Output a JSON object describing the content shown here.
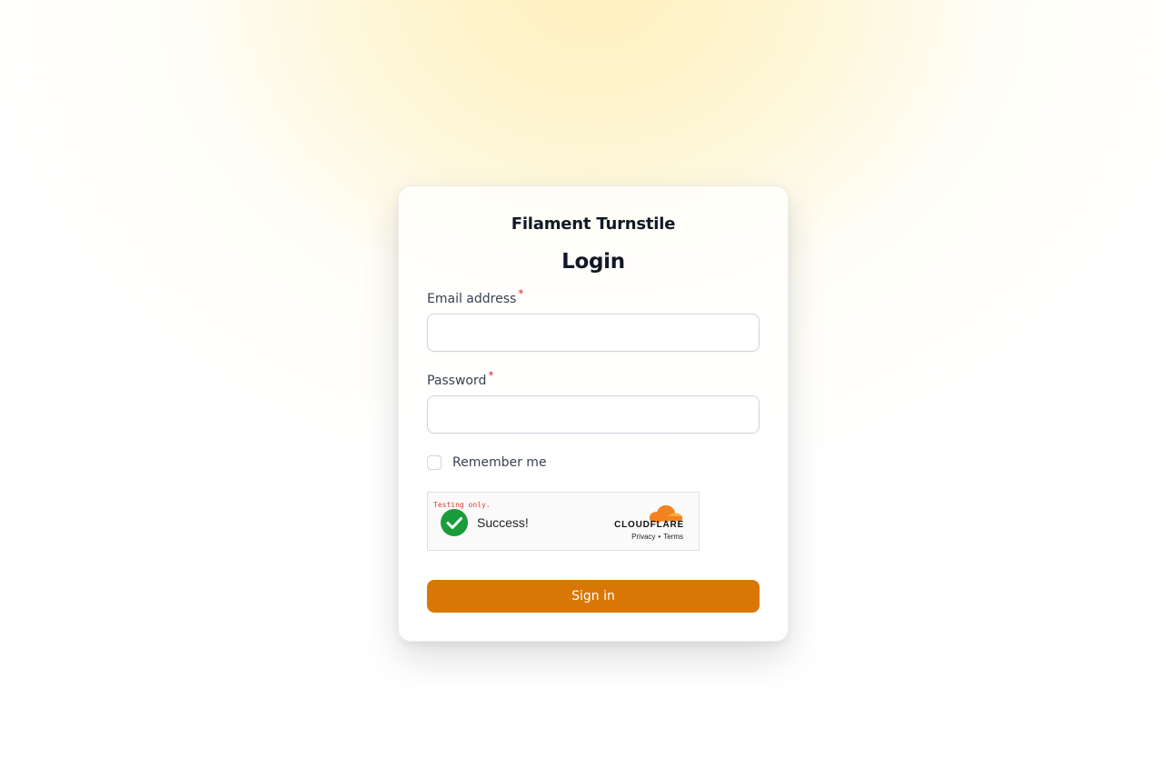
{
  "app": {
    "brand_name": "Filament Turnstile",
    "heading": "Login"
  },
  "form": {
    "email": {
      "label": "Email address",
      "required_mark": "*",
      "value": "",
      "placeholder": ""
    },
    "password": {
      "label": "Password",
      "required_mark": "*",
      "value": "",
      "placeholder": ""
    },
    "remember": {
      "label": "Remember me",
      "checked": false
    },
    "submit_label": "Sign in"
  },
  "turnstile": {
    "testing_text": "Testing only.",
    "status_text": "Success!",
    "status_icon": "check-circle-icon",
    "brand_text": "CLOUDFLARE",
    "brand_icon": "cloudflare-cloud-icon",
    "privacy_link": "Privacy",
    "separator": "•",
    "terms_link": "Terms"
  },
  "colors": {
    "primary": "#d97706",
    "required": "#dc2626",
    "success_green": "#1a9c3b",
    "cloudflare_orange": "#f48120"
  }
}
